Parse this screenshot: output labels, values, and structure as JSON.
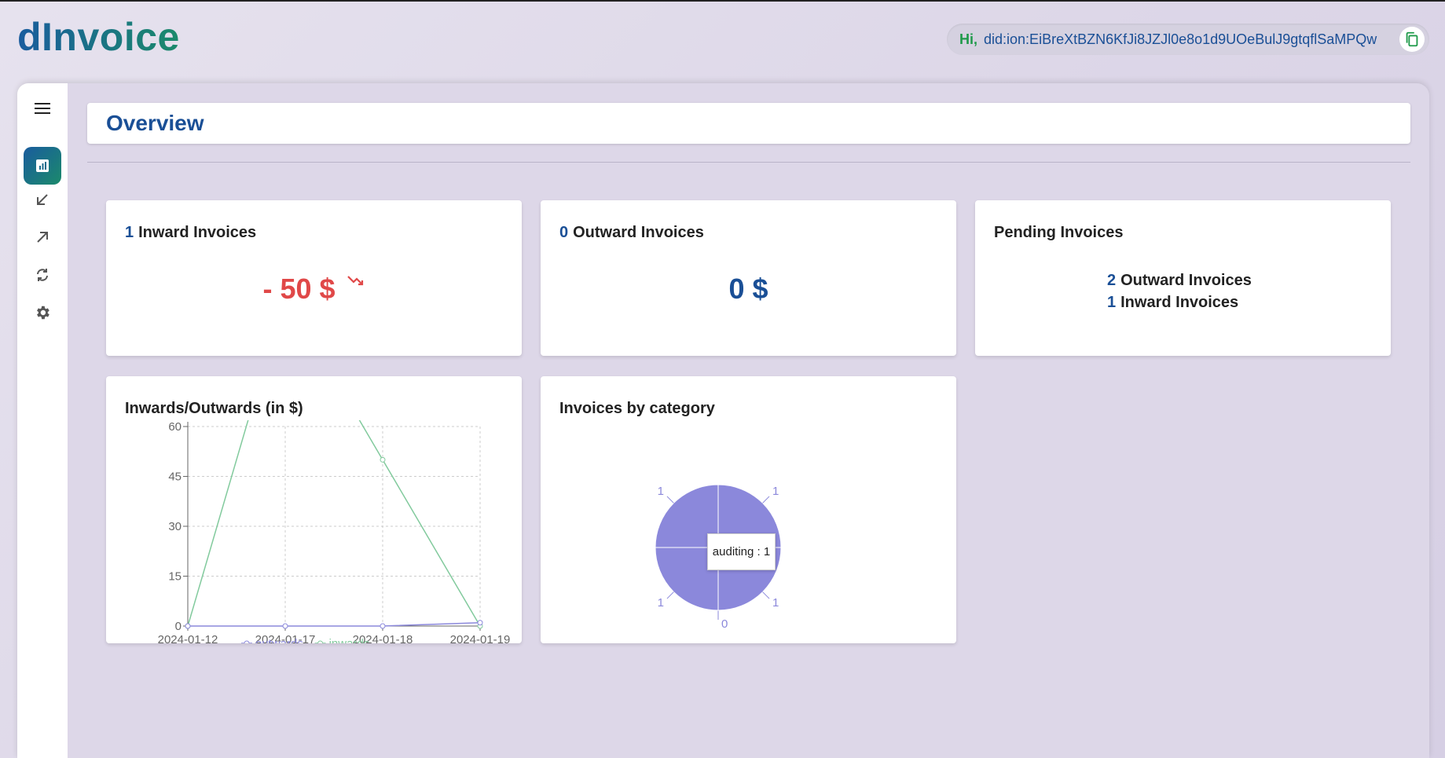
{
  "app": {
    "logo": "dInvoice",
    "greeting": "Hi,",
    "did": "did:ion:EiBreXtBZN6KfJi8JZJl0e8o1d9UOeBulJ9gtqflSaMPQw"
  },
  "sidebar": {
    "items": [
      {
        "icon": "menu-icon"
      },
      {
        "icon": "chart-icon",
        "active": true
      },
      {
        "icon": "arrow-down-left-icon"
      },
      {
        "icon": "arrow-up-right-icon"
      },
      {
        "icon": "sync-icon"
      },
      {
        "icon": "gear-icon"
      }
    ]
  },
  "page": {
    "title": "Overview"
  },
  "cards": {
    "inward": {
      "count": "1",
      "label": "Inward Invoices",
      "amount": "- 50 $"
    },
    "outward": {
      "count": "0",
      "label": "Outward Invoices",
      "amount": "0 $"
    },
    "pending": {
      "title": "Pending Invoices",
      "outward_count": "2",
      "outward_label": "Outward Invoices",
      "inward_count": "1",
      "inward_label": "Inward Invoices"
    }
  },
  "colors": {
    "brand": "#1a4f96",
    "negative": "#e04848",
    "outwards": "#8b88db",
    "inwards": "#82ca9d"
  },
  "chart_data": [
    {
      "type": "line",
      "title": "Inwards/Outwards (in $)",
      "categories": [
        "2024-01-12",
        "2024-01-17",
        "2024-01-18",
        "2024-01-19"
      ],
      "yticks": [
        "0",
        "15",
        "30",
        "45",
        "60"
      ],
      "ylim": [
        0,
        60
      ],
      "grid": true,
      "legend": "bottom",
      "series": [
        {
          "name": "outwards",
          "values": [
            0,
            0,
            0,
            1
          ]
        },
        {
          "name": "inwards",
          "values": [
            0,
            100,
            50,
            0
          ]
        }
      ]
    },
    {
      "type": "pie",
      "title": "Invoices by category",
      "slice_labels": [
        "1",
        "1",
        "0",
        "1",
        "1"
      ],
      "values": [
        1,
        1,
        0,
        1,
        1
      ],
      "tooltip": "auditing : 1"
    }
  ]
}
